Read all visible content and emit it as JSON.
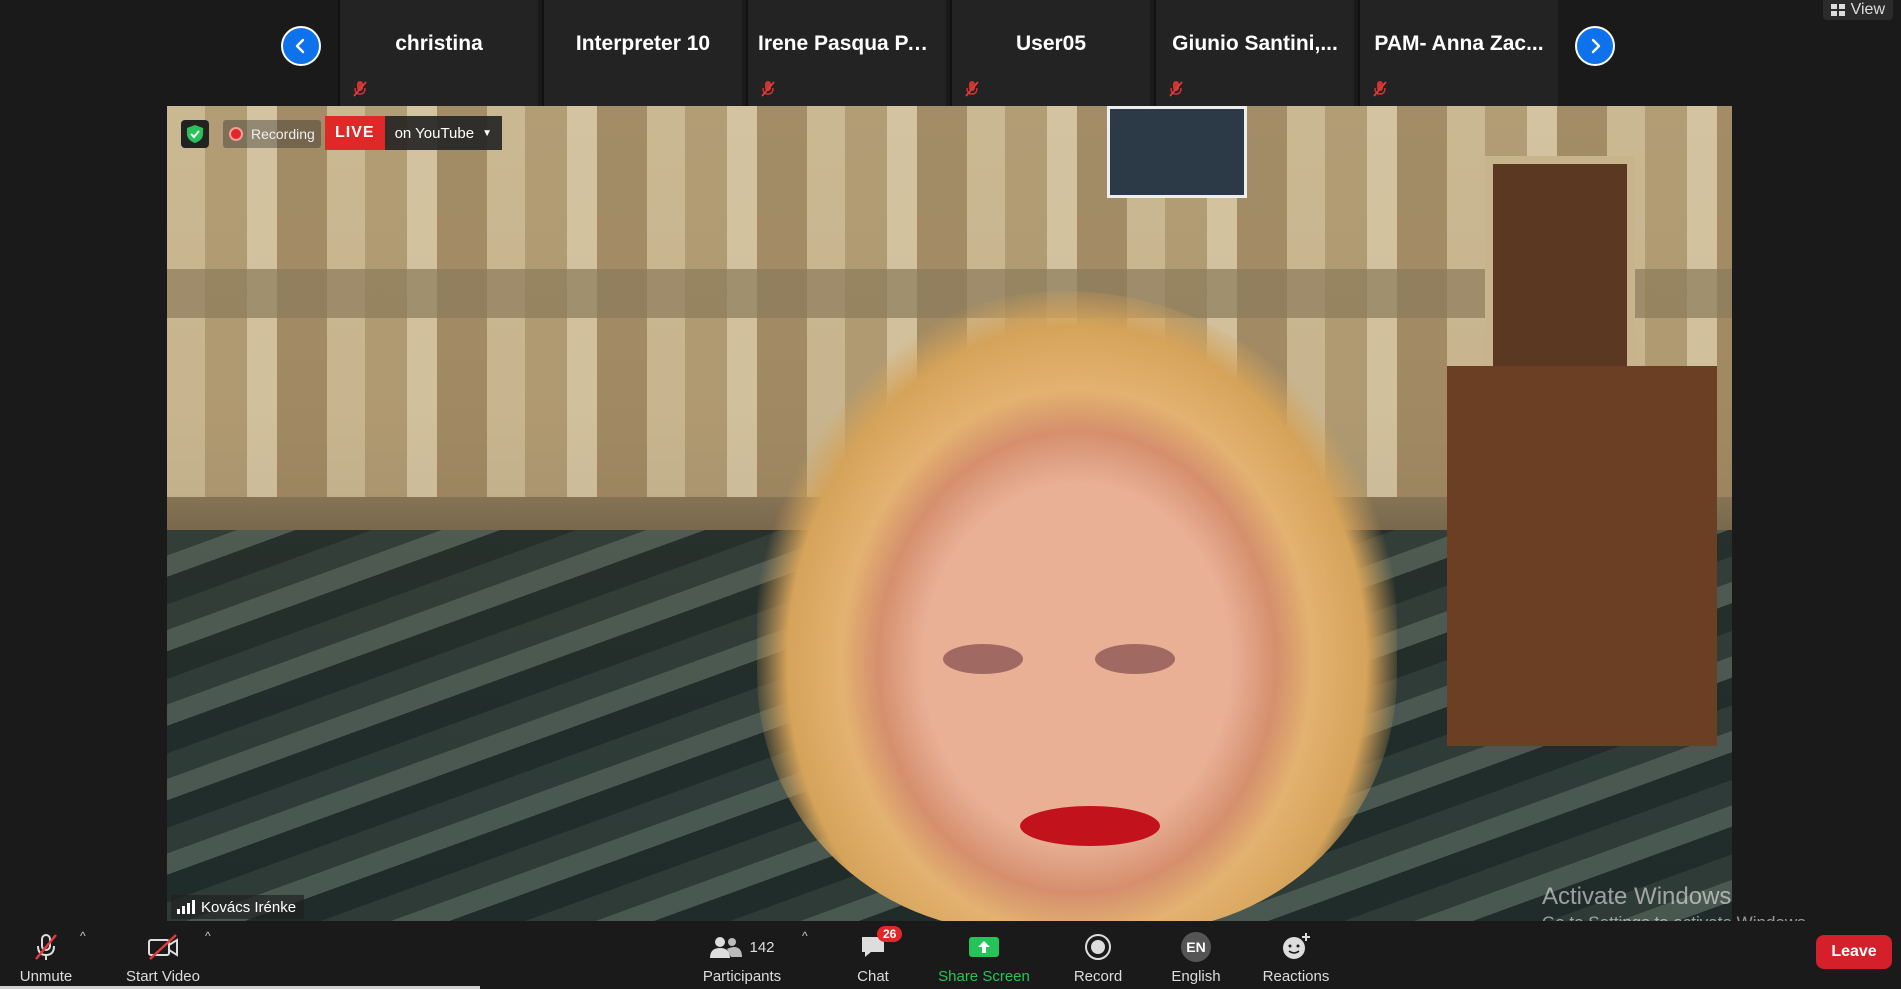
{
  "view_button": {
    "label": "View"
  },
  "participant_strip": {
    "tiles": [
      {
        "name": "christina"
      },
      {
        "name": "Interpreter 10"
      },
      {
        "name": "Irene Pasqua PAM"
      },
      {
        "name": "User05"
      },
      {
        "name": "Giunio  Santini,..."
      },
      {
        "name": "PAM- Anna Zac..."
      }
    ]
  },
  "video": {
    "recording_label": "Recording",
    "live_badge": "LIVE",
    "live_destination": "on YouTube",
    "speaker_name": "Kovács Irénke"
  },
  "watermark": {
    "title": "Activate Windows",
    "subtitle": "Go to Settings to activate Windows."
  },
  "toolbar": {
    "unmute_label": "Unmute",
    "start_video_label": "Start Video",
    "participants_label": "Participants",
    "participants_count": "142",
    "chat_label": "Chat",
    "chat_badge": "26",
    "share_screen_label": "Share Screen",
    "record_label": "Record",
    "language_code": "EN",
    "language_label": "English",
    "reactions_label": "Reactions",
    "leave_label": "Leave"
  },
  "colors": {
    "accent_blue": "#0e72ed",
    "live_red": "#e02828",
    "share_green": "#27c35a",
    "leave_red": "#d4202b",
    "muted_icon_red": "#e03a3a"
  }
}
